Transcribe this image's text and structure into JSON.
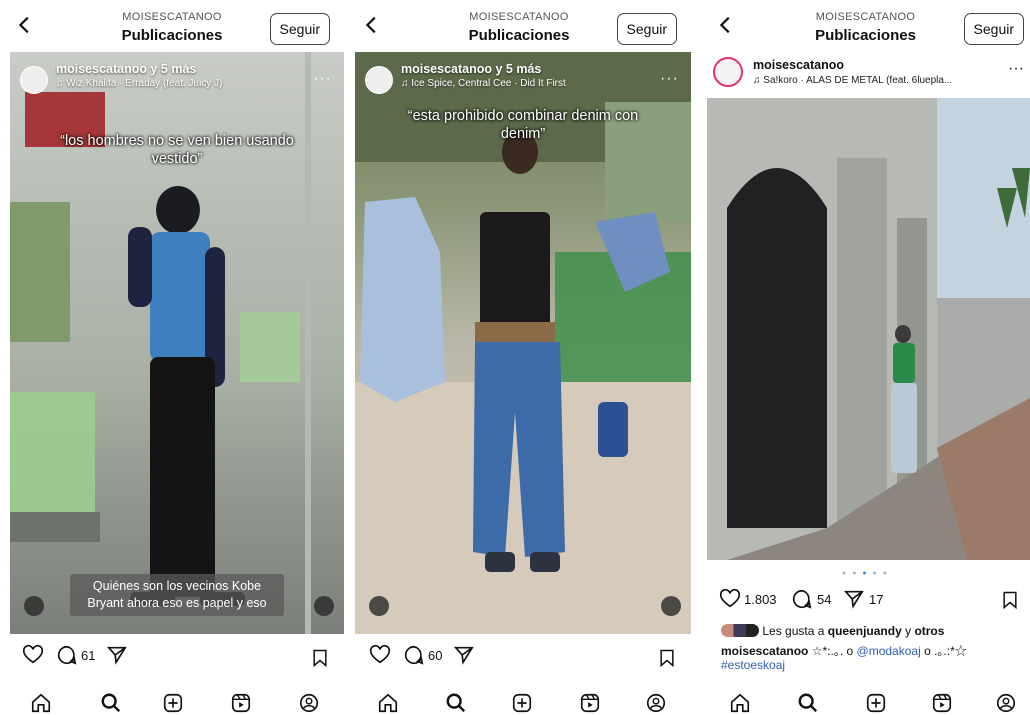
{
  "colors": {
    "accent": "#e1306c",
    "link": "#2f5fb3",
    "text": "#111111",
    "overlay": "#ffffff"
  },
  "icons": {
    "back": "chevron-left-icon",
    "music": "music-note-icon",
    "more": "more-dots-icon",
    "like": "heart-icon",
    "comment": "comment-icon",
    "share": "send-icon",
    "save": "bookmark-icon",
    "home": "home-icon",
    "search": "search-icon",
    "create": "plus-square-icon",
    "reels": "reels-icon",
    "profile": "profile-icon",
    "mute": "muted-speaker-icon",
    "tagged": "person-icon"
  },
  "panels": [
    {
      "header": {
        "subtitle": "MOISESCATANOO",
        "title": "Publicaciones",
        "follow": "Seguir"
      },
      "reel": {
        "owner": "moisescatanoo y 5 más",
        "music": "Wiz Khalifa · Erraday (feat. Juicy J)",
        "overlay_text": "“los hombres no se ven bien usando vestido”",
        "caption": "Quiénes son los vecinos Kobe Bryant ahora eso es papel y eso"
      },
      "actions": {
        "comments": "61"
      }
    },
    {
      "header": {
        "subtitle": "MOISESCATANOO",
        "title": "Publicaciones",
        "follow": "Seguir"
      },
      "reel": {
        "owner": "moisescatanoo y 5 más",
        "music": "Ice Spice, Central Cee · Did It First",
        "overlay_text": "“esta prohibido combinar denim con denim”"
      },
      "actions": {
        "comments": "60"
      }
    },
    {
      "header": {
        "subtitle": "MOISESCATANOO",
        "title": "Publicaciones",
        "follow": "Seguir"
      },
      "post": {
        "username": "moisescatanoo",
        "music": "Sa!koro · ALAS DE METAL (feat. 6luepla...",
        "likes": "1.803",
        "comments": "54",
        "shares": "17",
        "liked_by_prefix": "Les gusta a",
        "liked_by_user": "queenjuandy",
        "liked_by_and": "y",
        "liked_by_others": "otros",
        "caption_user": "moisescatanoo",
        "caption_text": "☆*:.｡. o",
        "caption_mention": "@modakoaj",
        "caption_tail": "o .｡.:*☆",
        "hashtag": "#estoeskoaj"
      }
    }
  ]
}
